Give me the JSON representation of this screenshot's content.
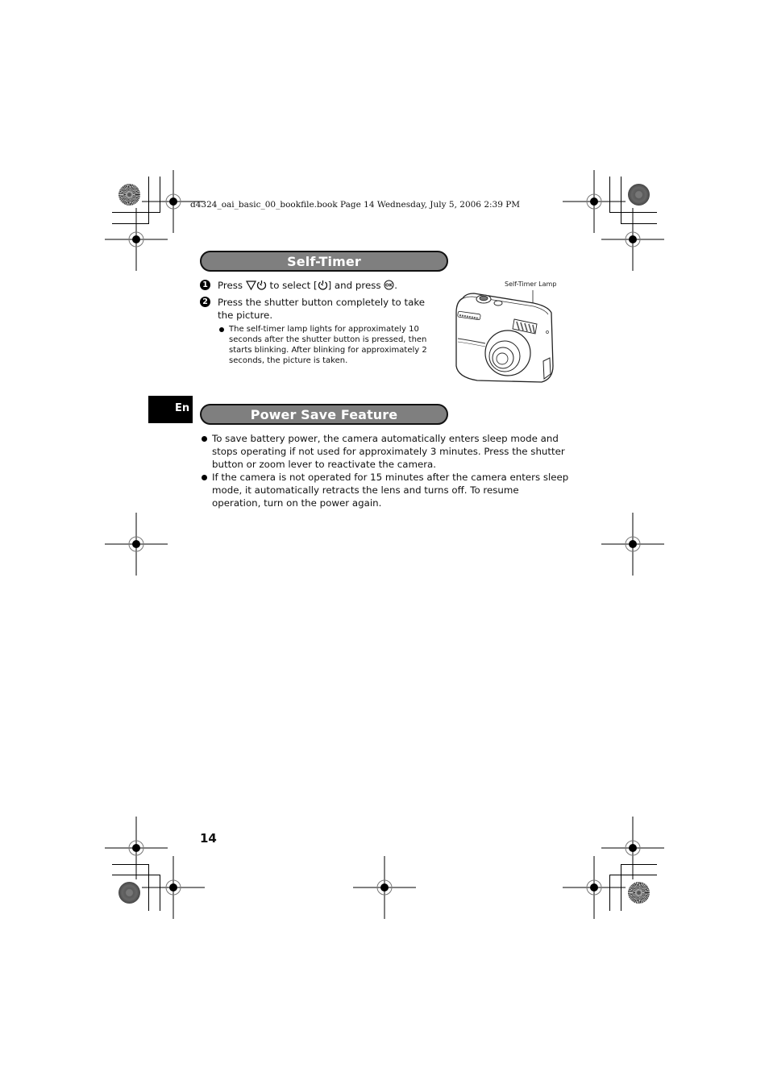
{
  "header": {
    "file_info": "d4324_oai_basic_00_bookfile.book  Page 14  Wednesday, July 5, 2006  2:39 PM"
  },
  "language_tab": "En",
  "self_timer": {
    "title": "Self-Timer",
    "steps": [
      {
        "number": "1",
        "parts": {
          "press": "Press ",
          "to_select": " to select [",
          "and_press": "] and press ",
          "end": "."
        },
        "icons": [
          "down-arrow-icon",
          "self-timer-icon",
          "ok-button-icon"
        ]
      },
      {
        "number": "2",
        "text": "Press the shutter button completely to take the picture."
      }
    ],
    "note": "The self-timer lamp lights for approximately 10 seconds after the shutter button is pressed, then starts blinking. After blinking for approximately 2 seconds, the picture is taken.",
    "illustration_label": "Self-Timer Lamp"
  },
  "power_save": {
    "title": "Power Save Feature",
    "bullets": [
      "To save battery power, the camera automatically enters sleep mode and stops operating if not used for approximately 3 minutes. Press the shutter button or zoom lever to reactivate the camera.",
      "If the camera is not operated for 15 minutes after the camera enters sleep mode, it automatically retracts the lens and turns off. To resume operation, turn on the power again."
    ]
  },
  "page_number": "14"
}
